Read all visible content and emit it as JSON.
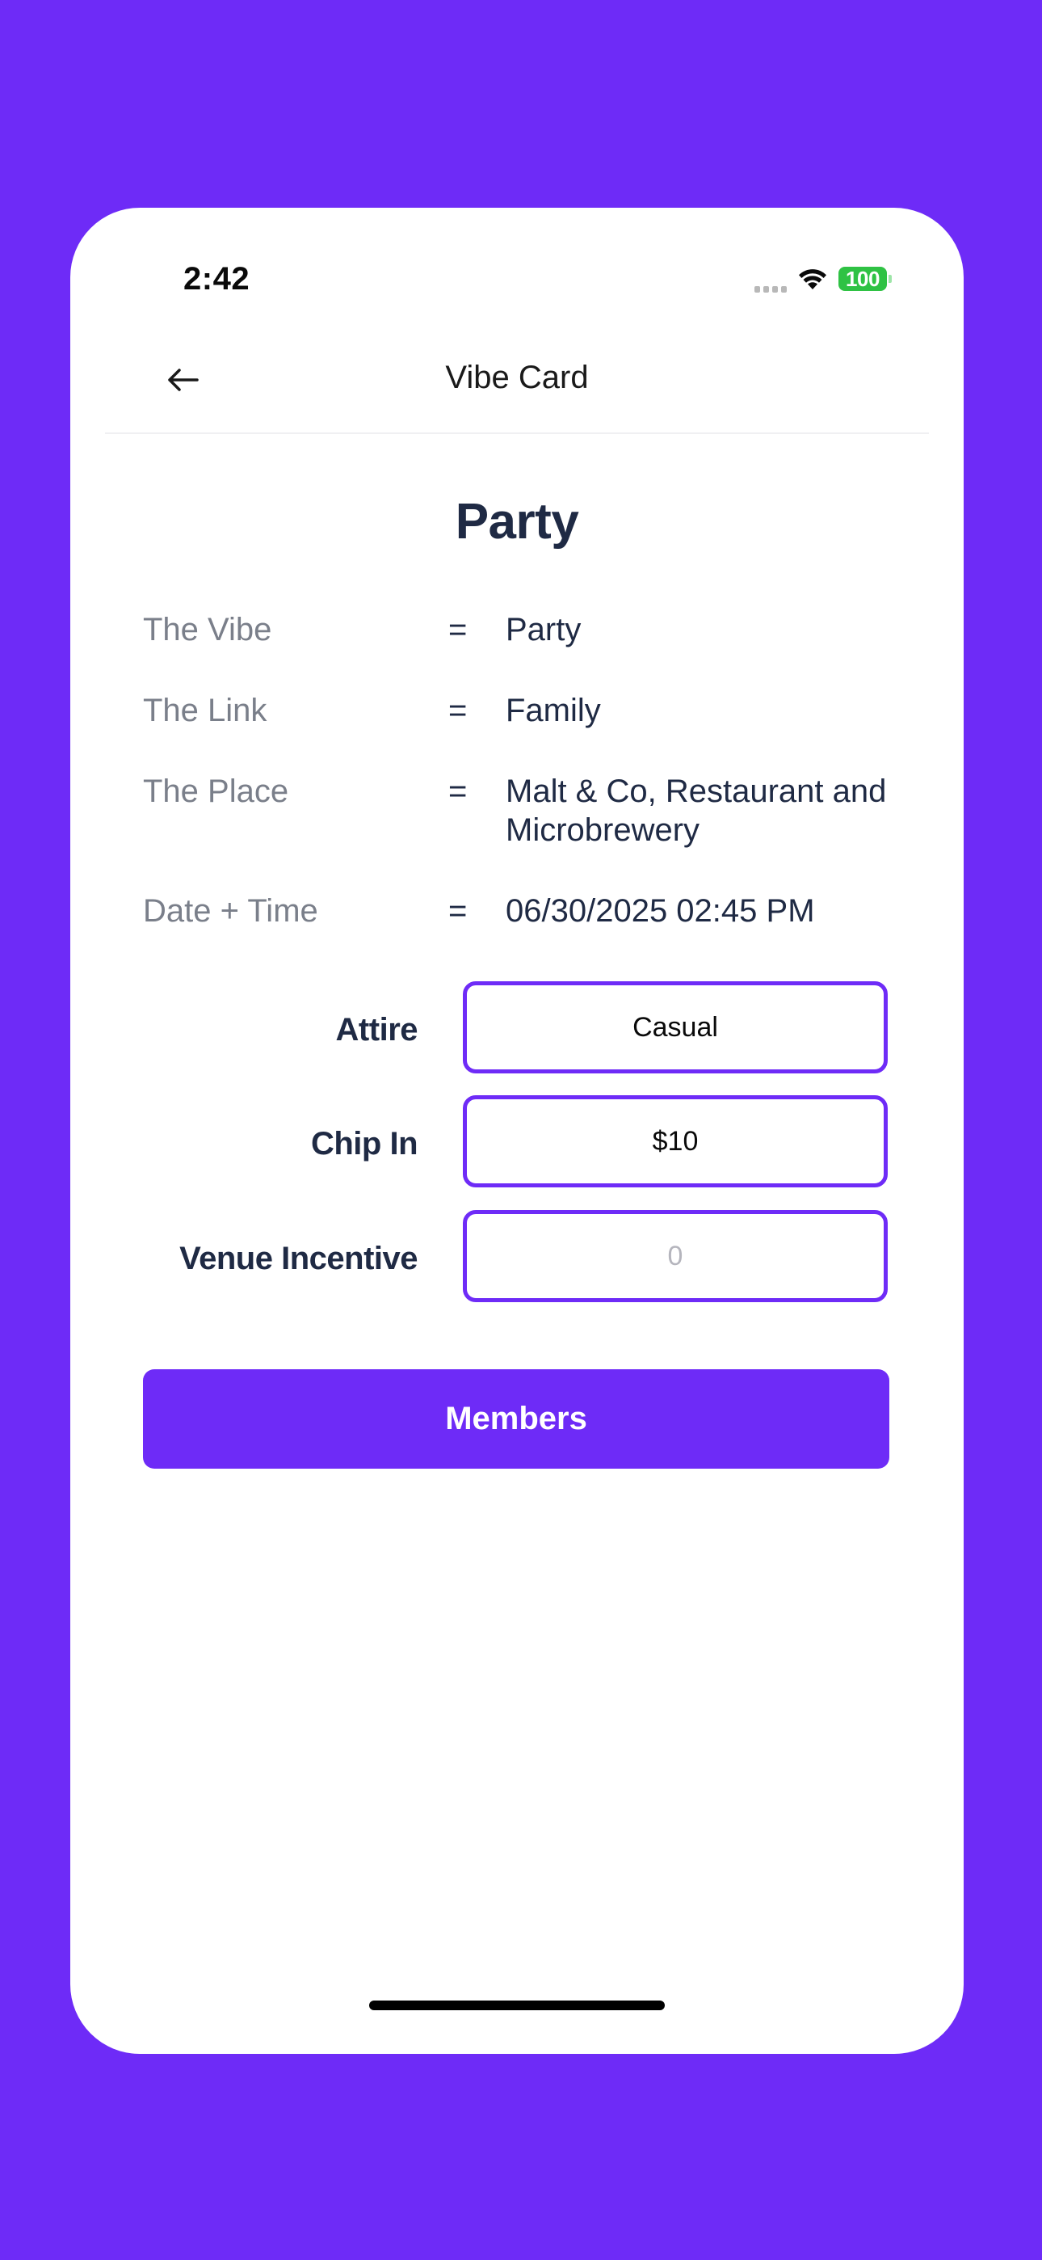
{
  "status_bar": {
    "time": "2:42",
    "battery": "100"
  },
  "header": {
    "title": "Vibe Card",
    "back_icon": "arrow-left-icon"
  },
  "page": {
    "title": "Party"
  },
  "details": [
    {
      "label": "The Vibe",
      "eq": "=",
      "value": "Party"
    },
    {
      "label": "The Link",
      "eq": "=",
      "value": "Family"
    },
    {
      "label": "The Place",
      "eq": "=",
      "value": "Malt & Co, Restaurant and Microbrewery"
    },
    {
      "label": "Date + Time",
      "eq": "=",
      "value": "06/30/2025 02:45 PM"
    }
  ],
  "fields": {
    "attire": {
      "label": "Attire",
      "value": "Casual"
    },
    "chip_in": {
      "label": "Chip In",
      "value": "$10"
    },
    "venue_incentive": {
      "label": "Venue Incentive",
      "placeholder": "0"
    }
  },
  "actions": {
    "members_label": "Members"
  },
  "colors": {
    "accent": "#6e2bf7",
    "text_dark": "#1f2a44",
    "text_muted": "#7a7f8a",
    "battery": "#2fc244"
  }
}
